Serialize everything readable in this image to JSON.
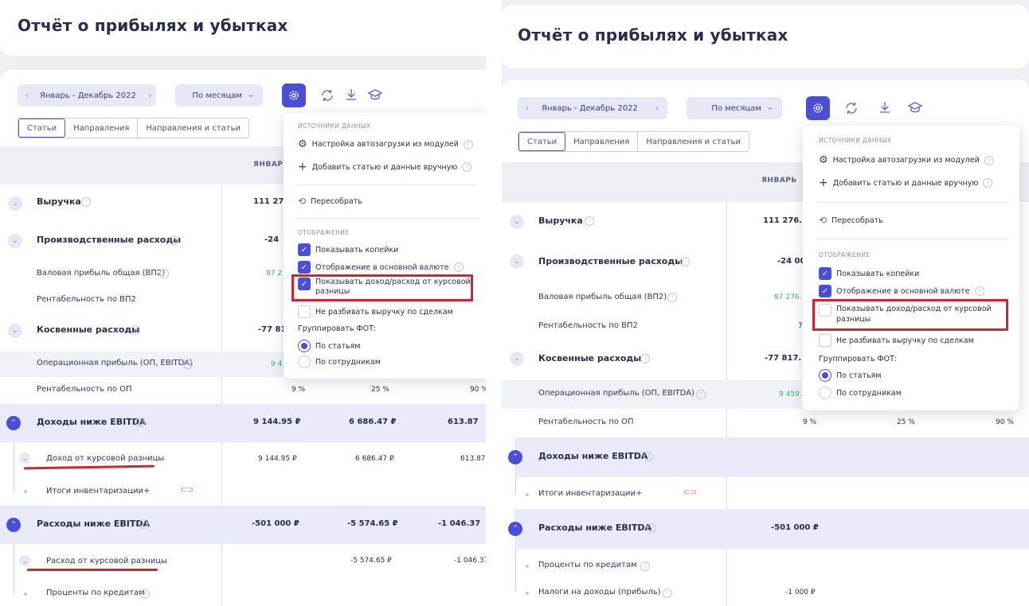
{
  "page_title": "Отчёт о прибылях и убытках",
  "period": {
    "label": "Январь - Декабрь 2022",
    "prev_arrow": "‹",
    "next_arrow": "›"
  },
  "grouping": {
    "label": "По месяцам",
    "chevron": "⌄"
  },
  "toolbar_icons": [
    "settings-icon",
    "refresh-icon",
    "download-icon",
    "graduation-cap-icon"
  ],
  "tabs": [
    "Статьи",
    "Направления",
    "Направления и статьи"
  ],
  "active_tab": "Статьи",
  "dropdown": {
    "sources_header": "ИСТОЧНИКИ ДАННЫХ",
    "autoload": "Настройка автозагрузки из модулей",
    "add_manual": "Добавить статью и данные вручную",
    "rebuild": "Пересобрать",
    "display_header": "ОТОБРАЖЕНИЕ",
    "show_kopecks": "Показывать копейки",
    "base_currency": "Отображение в основной валюте",
    "fx_line1": "Показывать доход/расход от курсовой",
    "fx_line2": "разницы",
    "no_split": "Не разбивать выручку по сделкам",
    "group_fot": "Группировать ФОТ:",
    "by_articles": "По статьям",
    "by_employees": "По сотрудникам"
  },
  "left": {
    "month_head": "ЯНВАР",
    "fx_checked": true,
    "rows": {
      "revenue": "Выручка",
      "revenue_v1": "111 27",
      "prod": "Производственные расходы",
      "prod_v1": "-24",
      "gross": "Валовая прибыль общая (ВП2)",
      "gross_v1": "87 2",
      "gross_margin": "Рентабельность по ВП2",
      "indirect": "Косвенные расходы",
      "indirect_v1": "-77 81",
      "ebitda": "Операционная прибыль (ОП, EBITDA)",
      "ebitda_v1": "9 4",
      "op_margin": "Рентабельность по ОП",
      "op_margin_v1": "9 %",
      "op_margin_v2": "25 %",
      "op_margin_v3": "90 %",
      "inc_below": "Доходы ниже EBITDA",
      "inc_below_v1": "9 144.95 ₽",
      "inc_below_v2": "6 686.47 ₽",
      "inc_below_v3": "613.87",
      "fx_income": "Доход от курсовой разницы",
      "fx_income_v1": "9 144.95 ₽",
      "fx_income_v2": "6 686.47 ₽",
      "fx_income_v3": "613.87",
      "inventory": "Итоги инвентаризации+",
      "exp_below": "Расходы ниже EBITDA",
      "exp_below_v1": "-501 000 ₽",
      "exp_below_v2": "-5 574.65 ₽",
      "exp_below_v3": "-1 046.37",
      "fx_expense": "Расход от курсовой разницы",
      "fx_expense_v2": "-5 574.65 ₽",
      "fx_expense_v3": "-1 046.37",
      "loan_interest": "Проценты по кредитам"
    }
  },
  "right": {
    "month_head": "ЯНВАРЬ",
    "fx_checked": false,
    "rows": {
      "revenue": "Выручка",
      "revenue_v1": "111 276.",
      "prod": "Производственные расходы",
      "prod_v1": "-24 00",
      "gross": "Валовая прибыль общая (ВП2)",
      "gross_v1": "87 276.",
      "gross_margin": "Рентабельность по ВП2",
      "gross_margin_v1": "7",
      "indirect": "Косвенные расходы",
      "indirect_v1": "-77 817.",
      "ebitda": "Операционная прибыль (ОП, EBITDA)",
      "ebitda_v1": "9 459.",
      "op_margin": "Рентабельность по ОП",
      "op_margin_v1": "9 %",
      "op_margin_v2": "25 %",
      "op_margin_v3": "90 %",
      "inc_below": "Доходы ниже EBITDA",
      "inventory": "Итоги инвентаризации+",
      "exp_below": "Расходы ниже EBITDA",
      "exp_below_v1": "-501 000 ₽",
      "loan_interest": "Проценты по кредитам",
      "income_tax": "Налоги на доходы (прибыль)",
      "income_tax_v1": "-1 000 ₽"
    }
  },
  "colors": {
    "accent": "#4b4ed8",
    "highlight_red": "#d5232f",
    "positive_green": "#3bb46b",
    "background": "#eef0f5"
  }
}
